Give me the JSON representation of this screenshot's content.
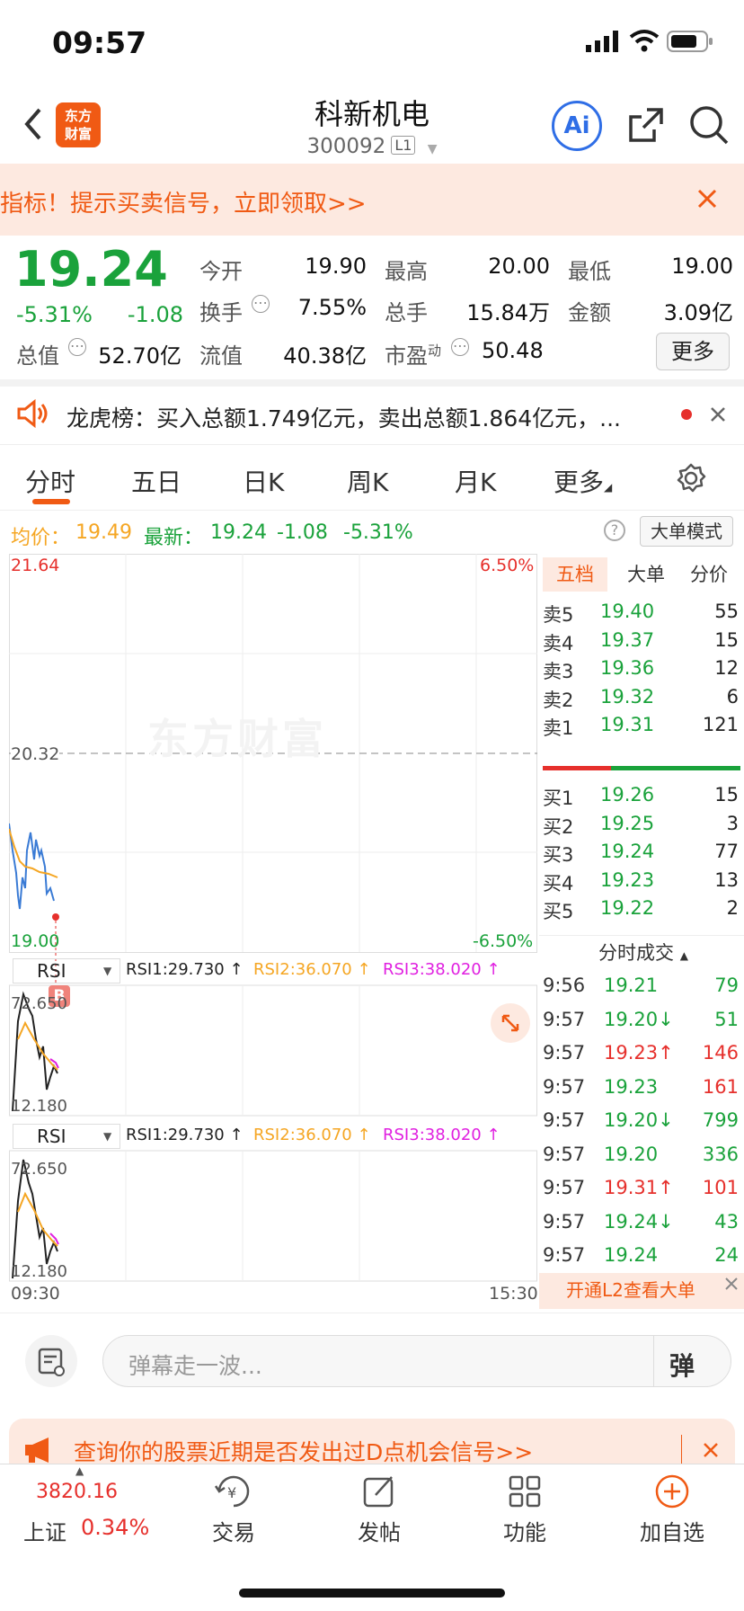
{
  "status": {
    "time": "09:57"
  },
  "header": {
    "name": "科新机电",
    "code": "300092",
    "level": "L1",
    "ai_label": "Ai"
  },
  "promo": {
    "text": "指标！提示买卖信号，立即领取>>"
  },
  "quote": {
    "price": "19.24",
    "pct": "-5.31%",
    "change": "-1.08",
    "open_label": "今开",
    "open": "19.90",
    "high_label": "最高",
    "high": "20.00",
    "low_label": "最低",
    "low": "19.00",
    "turnover_label": "换手",
    "turnover": "7.55%",
    "volume_label": "总手",
    "volume": "15.84万",
    "amount_label": "金额",
    "amount": "3.09亿",
    "mktcap_label": "总值",
    "mktcap": "52.70亿",
    "float_label": "流值",
    "float": "40.38亿",
    "pe_label": "市盈",
    "pe_sup": "动",
    "pe": "50.48",
    "more": "更多"
  },
  "lhb": {
    "text": "龙虎榜：买入总额1.749亿元，卖出总额1.864亿元，..."
  },
  "tabs": [
    "分时",
    "五日",
    "日K",
    "周K",
    "月K",
    "更多"
  ],
  "avgline": {
    "avg_label": "均价：",
    "avg": "19.49",
    "latest_label": "最新：",
    "latest": "19.24",
    "change": "-1.08",
    "pct": "-5.31%",
    "big_order": "大单模式"
  },
  "chart": {
    "y_top": "21.64",
    "y_mid": "20.32",
    "y_bottom": "19.00",
    "pct_top": "6.50%",
    "pct_bottom": "-6.50%",
    "watermark": "东方财富",
    "marker": "B",
    "time_start": "09:30",
    "time_end": "15:30",
    "rsi_panels": [
      {
        "name": "RSI",
        "r1": "RSI1:29.730 ↑",
        "r2": "RSI2:36.070 ↑",
        "r3": "RSI3:38.020 ↑",
        "top": "72.650",
        "bottom": "12.180"
      },
      {
        "name": "RSI",
        "r1": "RSI1:29.730 ↑",
        "r2": "RSI2:36.070 ↑",
        "r3": "RSI3:38.020 ↑",
        "top": "72.650",
        "bottom": "12.180"
      }
    ]
  },
  "orderbook": {
    "tabs": [
      "五档",
      "大单",
      "分价"
    ],
    "asks": [
      {
        "label": "卖5",
        "price": "19.40",
        "vol": "55"
      },
      {
        "label": "卖4",
        "price": "19.37",
        "vol": "15"
      },
      {
        "label": "卖3",
        "price": "19.36",
        "vol": "12"
      },
      {
        "label": "卖2",
        "price": "19.32",
        "vol": "6"
      },
      {
        "label": "卖1",
        "price": "19.31",
        "vol": "121"
      }
    ],
    "bids": [
      {
        "label": "买1",
        "price": "19.26",
        "vol": "15"
      },
      {
        "label": "买2",
        "price": "19.25",
        "vol": "3"
      },
      {
        "label": "买3",
        "price": "19.24",
        "vol": "77"
      },
      {
        "label": "买4",
        "price": "19.23",
        "vol": "13"
      },
      {
        "label": "买5",
        "price": "19.22",
        "vol": "2"
      }
    ],
    "trades_title": "分时成交",
    "trades": [
      {
        "time": "9:56",
        "price": "19.21",
        "vol": "79",
        "dir": "",
        "vol_color": "green"
      },
      {
        "time": "9:57",
        "price": "19.20↓",
        "vol": "51",
        "dir": "down",
        "vol_color": "green"
      },
      {
        "time": "9:57",
        "price": "19.23↑",
        "vol": "146",
        "dir": "up",
        "vol_color": "red"
      },
      {
        "time": "9:57",
        "price": "19.23",
        "vol": "161",
        "dir": "",
        "vol_color": "red"
      },
      {
        "time": "9:57",
        "price": "19.20↓",
        "vol": "799",
        "dir": "down",
        "vol_color": "green"
      },
      {
        "time": "9:57",
        "price": "19.20",
        "vol": "336",
        "dir": "",
        "vol_color": "green"
      },
      {
        "time": "9:57",
        "price": "19.31↑",
        "vol": "101",
        "dir": "up",
        "vol_color": "red"
      },
      {
        "time": "9:57",
        "price": "19.24↓",
        "vol": "43",
        "dir": "down",
        "vol_color": "green"
      },
      {
        "time": "9:57",
        "price": "19.24",
        "vol": "24",
        "dir": "",
        "vol_color": "green"
      }
    ],
    "l2_banner": "开通L2查看大单"
  },
  "input": {
    "placeholder": "弹幕走一波...",
    "danmu": "弹"
  },
  "ad": {
    "text": "查询你的股票近期是否发出过D点机会信号>>"
  },
  "tabbar": {
    "index_value": "3820.16",
    "index_name": "上证",
    "index_pct": "0.34%",
    "trade": "交易",
    "post": "发帖",
    "func": "功能",
    "add": "加自选"
  },
  "colors": {
    "up": "#e6302c",
    "down": "#1aa23b",
    "accent": "#f05a14",
    "price_line": "#3a7bd5",
    "avg_line": "#f5a623"
  }
}
